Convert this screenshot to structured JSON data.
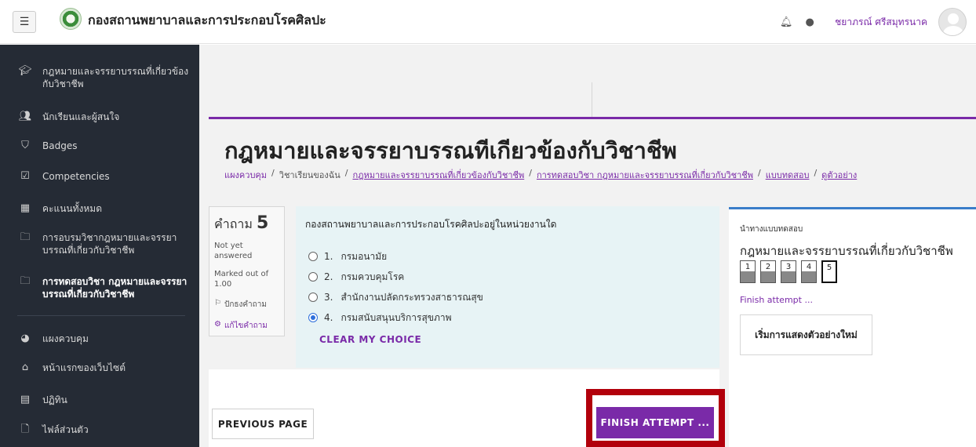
{
  "navbar": {
    "menu_icon": "hamburger-icon",
    "site_title": "กองสถานพยาบาลและการประกอบโรคศิลปะ",
    "user_name": "ชยาภรณ์ ศรีสมุทรนาค"
  },
  "sidebar": {
    "items": [
      {
        "icon": "graduation-cap-icon",
        "label": "กฎหมายและจรรยาบรรณที่เกี่ยวข้องกับวิชาชีพ"
      },
      {
        "icon": "users-icon",
        "label": "นักเรียนและผู้สนใจ"
      },
      {
        "icon": "shield-icon",
        "label": "Badges"
      },
      {
        "icon": "checkbox-icon",
        "label": "Competencies"
      },
      {
        "icon": "table-icon",
        "label": "คะแนนทั้งหมด"
      },
      {
        "icon": "folder-icon",
        "label": "การอบรมวิชากฎหมายและจรรยาบรรณที่เกี่ยวกับวิชาชีพ"
      },
      {
        "icon": "folder-icon",
        "label": "การทดสอบวิชา กฎหมายและจรรยาบรรณที่เกี่ยวกับวิชาชีพ"
      },
      {
        "icon": "dashboard-icon",
        "label": "แผงควบคุม"
      },
      {
        "icon": "home-icon",
        "label": "หน้าแรกของเว็บไซต์"
      },
      {
        "icon": "calendar-icon",
        "label": "ปฏิทิน"
      },
      {
        "icon": "file-icon",
        "label": "ไฟล์ส่วนตัว"
      }
    ]
  },
  "page": {
    "heading": "กฎหมายและจรรยาบรรณทีเกียวข้องกับวิชาชีพ",
    "breadcrumb": [
      "แผงควบคุม",
      "วิชาเรียนของฉัน",
      "กฎหมายและจรรยาบรรณที่เกี่ยวข้องกับวิชาชีพ",
      "การทดสอบวิชา กฎหมายและจรรยาบรรณที่เกี่ยวกับวิชาชีพ",
      "แบบทดสอบ",
      "ดูตัวอย่าง"
    ]
  },
  "question": {
    "label": "คำถาม",
    "number": "5",
    "state": "Not yet answered",
    "mark": "Marked out of 1.00",
    "flag": "ปักธงคำถาม",
    "edit": "แก้ไขคำถาม",
    "text": "กองสถานพยาบาลและการประกอบโรคศิลปะอยู่ในหน่วยงานใด",
    "answers": [
      {
        "num": "1.",
        "text": "กรมอนามัย",
        "checked": false
      },
      {
        "num": "2.",
        "text": "กรมควบคุมโรค",
        "checked": false
      },
      {
        "num": "3.",
        "text": "สำนักงานปลัดกระทรวงสาธารณสุข",
        "checked": false
      },
      {
        "num": "4.",
        "text": "กรมสนับสนุนบริการสุขภาพ",
        "checked": true
      }
    ],
    "clear_choice": "CLEAR MY CHOICE"
  },
  "nav_panel": {
    "title": "นำทางแบบทดสอบ",
    "quiz_name": "กฎหมายและจรรยาบรรณที่เกี่ยวกับวิชาชีพ",
    "questions": [
      "1",
      "2",
      "3",
      "4",
      "5"
    ],
    "current": "5",
    "finish_link": "Finish attempt ...",
    "preview_button": "เริ่มการแสดงตัวอย่างใหม่"
  },
  "buttons": {
    "previous": "PREVIOUS PAGE",
    "finish": "FINISH ATTEMPT ..."
  }
}
